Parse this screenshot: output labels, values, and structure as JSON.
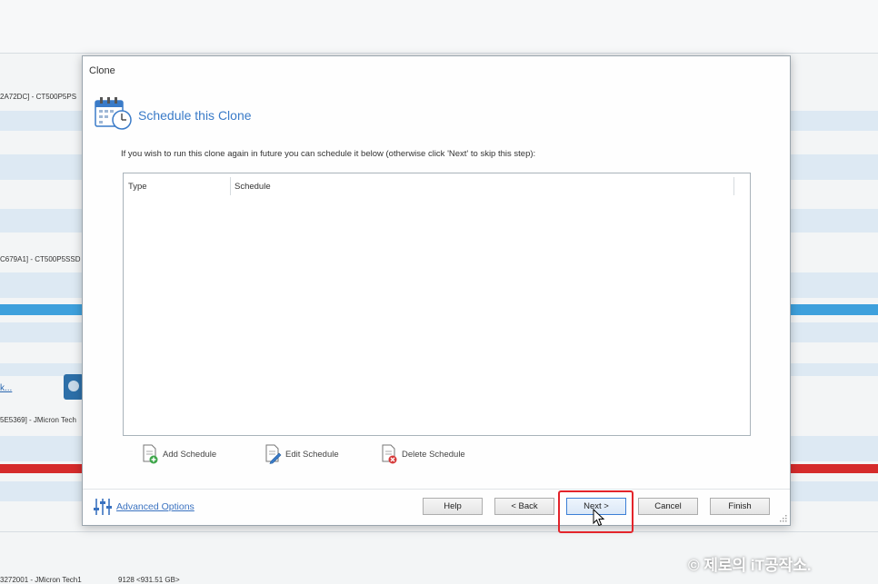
{
  "background": {
    "rows": [
      "2A72DC] - CT500P5PS",
      "C679A1] - CT500P5SSD",
      "5E5369] - JMicron  Tech",
      "3272001 - JMicron  Tech1"
    ],
    "link_text": "k...",
    "bottom_info": "9128  <931.51 GB>"
  },
  "dialog": {
    "title": "Clone",
    "header_title": "Schedule this Clone",
    "instruction": "If you wish to run this clone again in future you can schedule it below (otherwise click 'Next' to skip this step):",
    "table": {
      "columns": [
        "Type",
        "Schedule"
      ],
      "rows": []
    },
    "actions": {
      "add": "Add Schedule",
      "edit": "Edit Schedule",
      "delete": "Delete Schedule"
    },
    "advanced_options": "Advanced Options",
    "buttons": {
      "help": "Help",
      "back": "< Back",
      "next": "Next >",
      "cancel": "Cancel",
      "finish": "Finish"
    }
  },
  "watermark": "© 제로의 iT공작소.",
  "colors": {
    "accent_blue": "#3a7bc8",
    "highlight_red": "#e3242b",
    "band_blue": "#3ea0dc",
    "band_red": "#d52b2b"
  }
}
